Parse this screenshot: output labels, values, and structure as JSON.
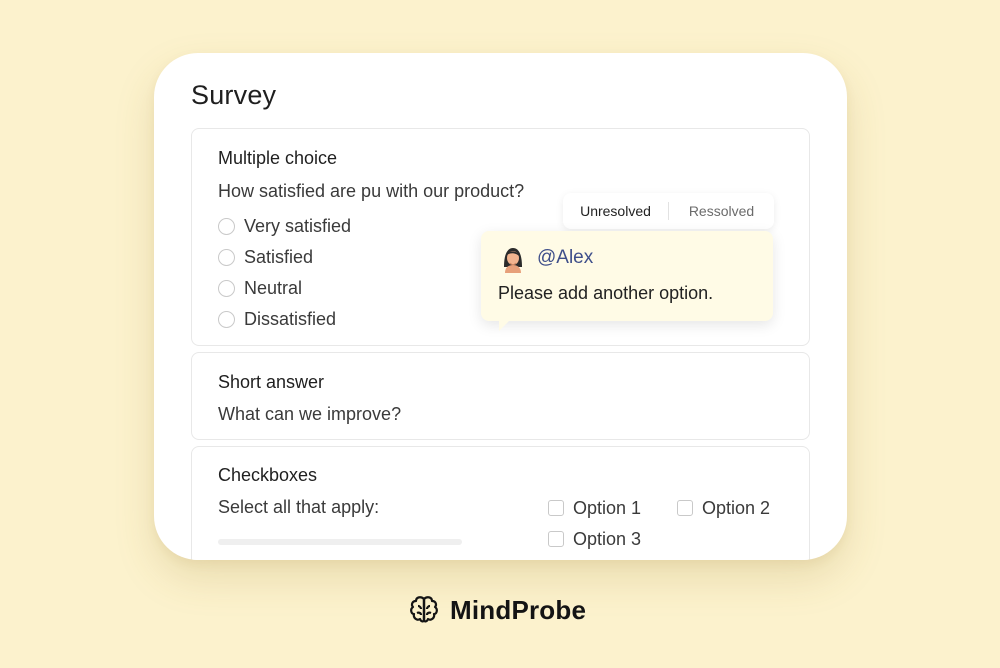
{
  "survey": {
    "title": "Survey",
    "multiple_choice": {
      "title": "Multiple choice",
      "question": "How satisfied are pu with our product?",
      "options": [
        "Very satisfied",
        "Satisfied",
        "Neutral",
        "Dissatisfied"
      ]
    },
    "short_answer": {
      "title": "Short answer",
      "question": "What can we improve?"
    },
    "checkboxes": {
      "title": "Checkboxes",
      "prompt": "Select all that apply:",
      "options": [
        "Option 1",
        "Option 2",
        "Option 3"
      ]
    }
  },
  "comment_tabs": {
    "unresolved": "Unresolved",
    "resolved": "Ressolved"
  },
  "comment": {
    "mention": "@Alex",
    "text": "Please add another option."
  },
  "brand": {
    "name": "MindProbe",
    "icon": "brain-icon"
  },
  "colors": {
    "background": "#fcf2cd",
    "comment_bg": "#fffbe6",
    "mention": "#3f4f8a",
    "arrow": "#4a7fd6"
  }
}
